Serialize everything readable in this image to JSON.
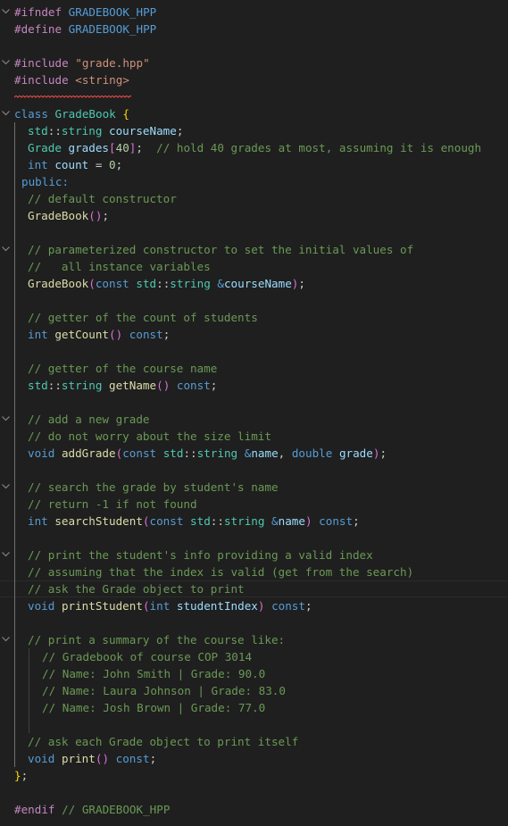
{
  "editor": {
    "language": "cpp",
    "file_kind": "header",
    "theme_colors": {
      "background": "#1f1f1f",
      "preprocessor": "#c586c0",
      "macro": "#569cd6",
      "string": "#ce9178",
      "keyword": "#569cd6",
      "type": "#4ec9b0",
      "variable": "#9cdcfe",
      "function": "#dcdcaa",
      "comment": "#6a9955",
      "number": "#b5cea8",
      "bracket_level_1": "#ffd700",
      "bracket_level_2": "#da70d6",
      "error_squiggle": "#f14c4c"
    },
    "lines": [
      {
        "indent": 0,
        "fold": true,
        "tokens": [
          {
            "t": "#ifndef",
            "c": "pp"
          },
          {
            "t": " ",
            "c": "p"
          },
          {
            "t": "GRADEBOOK_HPP",
            "c": "macro"
          }
        ]
      },
      {
        "indent": 0,
        "fold": false,
        "tokens": [
          {
            "t": "#define",
            "c": "pp"
          },
          {
            "t": " ",
            "c": "p"
          },
          {
            "t": "GRADEBOOK_HPP",
            "c": "macro"
          }
        ]
      },
      {
        "indent": 0,
        "fold": false,
        "tokens": []
      },
      {
        "indent": 0,
        "fold": true,
        "tokens": [
          {
            "t": "#include",
            "c": "pp"
          },
          {
            "t": " ",
            "c": "p"
          },
          {
            "t": "\"grade.hpp\"",
            "c": "str"
          }
        ]
      },
      {
        "indent": 0,
        "fold": false,
        "error": true,
        "tokens": [
          {
            "t": "#include",
            "c": "pp"
          },
          {
            "t": " ",
            "c": "p"
          },
          {
            "t": "<string>",
            "c": "str"
          }
        ]
      },
      {
        "indent": 0,
        "fold": false,
        "tokens": []
      },
      {
        "indent": 0,
        "fold": true,
        "tokens": [
          {
            "t": "class",
            "c": "kw"
          },
          {
            "t": " ",
            "c": "p"
          },
          {
            "t": "GradeBook",
            "c": "cls"
          },
          {
            "t": " ",
            "c": "p"
          },
          {
            "t": "{",
            "c": "br1"
          }
        ]
      },
      {
        "indent": 2,
        "fold": false,
        "tokens": [
          {
            "t": "std",
            "c": "type"
          },
          {
            "t": "::",
            "c": "p"
          },
          {
            "t": "string",
            "c": "type"
          },
          {
            "t": " ",
            "c": "p"
          },
          {
            "t": "courseName",
            "c": "var"
          },
          {
            "t": ";",
            "c": "p"
          }
        ]
      },
      {
        "indent": 2,
        "fold": false,
        "tokens": [
          {
            "t": "Grade",
            "c": "cls"
          },
          {
            "t": " ",
            "c": "p"
          },
          {
            "t": "grades",
            "c": "var"
          },
          {
            "t": "[",
            "c": "br2"
          },
          {
            "t": "40",
            "c": "num"
          },
          {
            "t": "]",
            "c": "br2"
          },
          {
            "t": ";",
            "c": "p"
          },
          {
            "t": "  ",
            "c": "p"
          },
          {
            "t": "// hold 40 grades at most, assuming it is enough",
            "c": "cm"
          }
        ]
      },
      {
        "indent": 2,
        "fold": false,
        "tokens": [
          {
            "t": "int",
            "c": "kw"
          },
          {
            "t": " ",
            "c": "p"
          },
          {
            "t": "count",
            "c": "var"
          },
          {
            "t": " = ",
            "c": "p"
          },
          {
            "t": "0",
            "c": "num"
          },
          {
            "t": ";",
            "c": "p"
          }
        ]
      },
      {
        "indent": 1,
        "fold": false,
        "tokens": [
          {
            "t": "public:",
            "c": "kw"
          }
        ]
      },
      {
        "indent": 2,
        "fold": false,
        "tokens": [
          {
            "t": "// default constructor",
            "c": "cm"
          }
        ]
      },
      {
        "indent": 2,
        "fold": false,
        "tokens": [
          {
            "t": "GradeBook",
            "c": "fn"
          },
          {
            "t": "(",
            "c": "br2"
          },
          {
            "t": ")",
            "c": "br2"
          },
          {
            "t": ";",
            "c": "p"
          }
        ]
      },
      {
        "indent": 2,
        "fold": false,
        "tokens": []
      },
      {
        "indent": 2,
        "fold": true,
        "tokens": [
          {
            "t": "// parameterized constructor to set the initial values of",
            "c": "cm"
          }
        ]
      },
      {
        "indent": 2,
        "fold": false,
        "tokens": [
          {
            "t": "//   all instance variables",
            "c": "cm"
          }
        ]
      },
      {
        "indent": 2,
        "fold": false,
        "tokens": [
          {
            "t": "GradeBook",
            "c": "fn"
          },
          {
            "t": "(",
            "c": "br2"
          },
          {
            "t": "const",
            "c": "kw"
          },
          {
            "t": " ",
            "c": "p"
          },
          {
            "t": "std",
            "c": "type"
          },
          {
            "t": "::",
            "c": "p"
          },
          {
            "t": "string",
            "c": "type"
          },
          {
            "t": " ",
            "c": "p"
          },
          {
            "t": "&",
            "c": "kw"
          },
          {
            "t": "courseName",
            "c": "var"
          },
          {
            "t": ")",
            "c": "br2"
          },
          {
            "t": ";",
            "c": "p"
          }
        ]
      },
      {
        "indent": 2,
        "fold": false,
        "tokens": []
      },
      {
        "indent": 2,
        "fold": false,
        "tokens": [
          {
            "t": "// getter of the count of students",
            "c": "cm"
          }
        ]
      },
      {
        "indent": 2,
        "fold": false,
        "tokens": [
          {
            "t": "int",
            "c": "kw"
          },
          {
            "t": " ",
            "c": "p"
          },
          {
            "t": "getCount",
            "c": "fn"
          },
          {
            "t": "(",
            "c": "br2"
          },
          {
            "t": ")",
            "c": "br2"
          },
          {
            "t": " ",
            "c": "p"
          },
          {
            "t": "const",
            "c": "kw"
          },
          {
            "t": ";",
            "c": "p"
          }
        ]
      },
      {
        "indent": 2,
        "fold": false,
        "tokens": []
      },
      {
        "indent": 2,
        "fold": false,
        "tokens": [
          {
            "t": "// getter of the course name",
            "c": "cm"
          }
        ]
      },
      {
        "indent": 2,
        "fold": false,
        "tokens": [
          {
            "t": "std",
            "c": "type"
          },
          {
            "t": "::",
            "c": "p"
          },
          {
            "t": "string",
            "c": "type"
          },
          {
            "t": " ",
            "c": "p"
          },
          {
            "t": "getName",
            "c": "fn"
          },
          {
            "t": "(",
            "c": "br2"
          },
          {
            "t": ")",
            "c": "br2"
          },
          {
            "t": " ",
            "c": "p"
          },
          {
            "t": "const",
            "c": "kw"
          },
          {
            "t": ";",
            "c": "p"
          }
        ]
      },
      {
        "indent": 2,
        "fold": false,
        "tokens": []
      },
      {
        "indent": 2,
        "fold": true,
        "tokens": [
          {
            "t": "// add a new grade",
            "c": "cm"
          }
        ]
      },
      {
        "indent": 2,
        "fold": false,
        "tokens": [
          {
            "t": "// do not worry about the size limit",
            "c": "cm"
          }
        ]
      },
      {
        "indent": 2,
        "fold": false,
        "tokens": [
          {
            "t": "void",
            "c": "kw"
          },
          {
            "t": " ",
            "c": "p"
          },
          {
            "t": "addGrade",
            "c": "fn"
          },
          {
            "t": "(",
            "c": "br2"
          },
          {
            "t": "const",
            "c": "kw"
          },
          {
            "t": " ",
            "c": "p"
          },
          {
            "t": "std",
            "c": "type"
          },
          {
            "t": "::",
            "c": "p"
          },
          {
            "t": "string",
            "c": "type"
          },
          {
            "t": " ",
            "c": "p"
          },
          {
            "t": "&",
            "c": "kw"
          },
          {
            "t": "name",
            "c": "var"
          },
          {
            "t": ", ",
            "c": "p"
          },
          {
            "t": "double",
            "c": "kw"
          },
          {
            "t": " ",
            "c": "p"
          },
          {
            "t": "grade",
            "c": "var"
          },
          {
            "t": ")",
            "c": "br2"
          },
          {
            "t": ";",
            "c": "p"
          }
        ]
      },
      {
        "indent": 2,
        "fold": false,
        "tokens": []
      },
      {
        "indent": 2,
        "fold": true,
        "tokens": [
          {
            "t": "// search the grade by student's name",
            "c": "cm"
          }
        ]
      },
      {
        "indent": 2,
        "fold": false,
        "tokens": [
          {
            "t": "// return -1 if not found",
            "c": "cm"
          }
        ]
      },
      {
        "indent": 2,
        "fold": false,
        "tokens": [
          {
            "t": "int",
            "c": "kw"
          },
          {
            "t": " ",
            "c": "p"
          },
          {
            "t": "searchStudent",
            "c": "fn"
          },
          {
            "t": "(",
            "c": "br2"
          },
          {
            "t": "const",
            "c": "kw"
          },
          {
            "t": " ",
            "c": "p"
          },
          {
            "t": "std",
            "c": "type"
          },
          {
            "t": "::",
            "c": "p"
          },
          {
            "t": "string",
            "c": "type"
          },
          {
            "t": " ",
            "c": "p"
          },
          {
            "t": "&",
            "c": "kw"
          },
          {
            "t": "name",
            "c": "var"
          },
          {
            "t": ")",
            "c": "br2"
          },
          {
            "t": " ",
            "c": "p"
          },
          {
            "t": "const",
            "c": "kw"
          },
          {
            "t": ";",
            "c": "p"
          }
        ]
      },
      {
        "indent": 2,
        "fold": false,
        "tokens": []
      },
      {
        "indent": 2,
        "fold": true,
        "tokens": [
          {
            "t": "// print the student's info providing a valid index",
            "c": "cm"
          }
        ]
      },
      {
        "indent": 2,
        "fold": false,
        "tokens": [
          {
            "t": "// assuming that the index is valid (get from the search)",
            "c": "cm"
          }
        ]
      },
      {
        "indent": 2,
        "fold": false,
        "current": true,
        "tokens": [
          {
            "t": "// ask the Grade object to print",
            "c": "cm"
          }
        ]
      },
      {
        "indent": 2,
        "fold": false,
        "tokens": [
          {
            "t": "void",
            "c": "kw"
          },
          {
            "t": " ",
            "c": "p"
          },
          {
            "t": "printStudent",
            "c": "fn"
          },
          {
            "t": "(",
            "c": "br2"
          },
          {
            "t": "int",
            "c": "kw"
          },
          {
            "t": " ",
            "c": "p"
          },
          {
            "t": "studentIndex",
            "c": "var"
          },
          {
            "t": ")",
            "c": "br2"
          },
          {
            "t": " ",
            "c": "p"
          },
          {
            "t": "const",
            "c": "kw"
          },
          {
            "t": ";",
            "c": "p"
          }
        ]
      },
      {
        "indent": 2,
        "fold": false,
        "tokens": []
      },
      {
        "indent": 2,
        "fold": true,
        "tokens": [
          {
            "t": "// print a summary of the course like:",
            "c": "cm"
          }
        ]
      },
      {
        "indent": 4,
        "fold": false,
        "tokens": [
          {
            "t": "// Gradebook of course COP 3014",
            "c": "cm"
          }
        ]
      },
      {
        "indent": 4,
        "fold": false,
        "tokens": [
          {
            "t": "// Name: John Smith | Grade: 90.0",
            "c": "cm"
          }
        ]
      },
      {
        "indent": 4,
        "fold": false,
        "tokens": [
          {
            "t": "// Name: Laura Johnson | Grade: 83.0",
            "c": "cm"
          }
        ]
      },
      {
        "indent": 4,
        "fold": false,
        "tokens": [
          {
            "t": "// Name: Josh Brown | Grade: 77.0",
            "c": "cm"
          }
        ]
      },
      {
        "indent": 4,
        "fold": false,
        "tokens": []
      },
      {
        "indent": 2,
        "fold": false,
        "tokens": [
          {
            "t": "// ask each Grade object to print itself",
            "c": "cm"
          }
        ]
      },
      {
        "indent": 2,
        "fold": false,
        "tokens": [
          {
            "t": "void",
            "c": "kw"
          },
          {
            "t": " ",
            "c": "p"
          },
          {
            "t": "print",
            "c": "fn"
          },
          {
            "t": "(",
            "c": "br2"
          },
          {
            "t": ")",
            "c": "br2"
          },
          {
            "t": " ",
            "c": "p"
          },
          {
            "t": "const",
            "c": "kw"
          },
          {
            "t": ";",
            "c": "p"
          }
        ]
      },
      {
        "indent": 0,
        "fold": false,
        "tokens": [
          {
            "t": "}",
            "c": "br1"
          },
          {
            "t": ";",
            "c": "p"
          }
        ]
      },
      {
        "indent": 0,
        "fold": false,
        "tokens": []
      },
      {
        "indent": 0,
        "fold": false,
        "tokens": [
          {
            "t": "#endif",
            "c": "pp"
          },
          {
            "t": " ",
            "c": "p"
          },
          {
            "t": "// GRADEBOOK_HPP",
            "c": "cm"
          }
        ]
      }
    ]
  }
}
